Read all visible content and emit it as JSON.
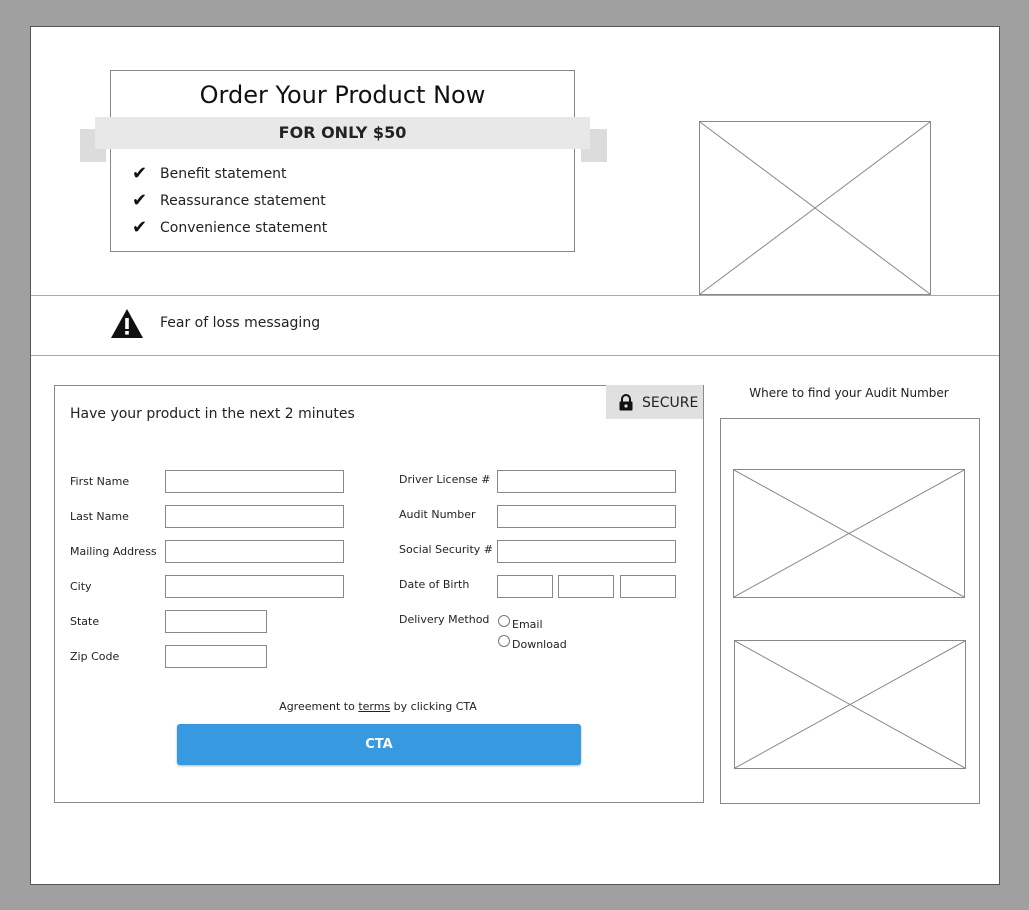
{
  "hero": {
    "title": "Order Your Product Now",
    "price_banner": "FOR ONLY $50",
    "benefits": [
      "Benefit statement",
      "Reassurance statement",
      "Convenience statement"
    ]
  },
  "alert": {
    "message": "Fear of loss messaging",
    "icon": "warning-triangle-icon"
  },
  "form": {
    "heading": "Have your product in the next 2 minutes",
    "secure_label": "SECURE",
    "secure_icon": "lock-icon",
    "left_fields": [
      "First Name",
      "Last Name",
      "Mailing Address",
      "City",
      "State",
      "Zip Code"
    ],
    "right_fields": [
      "Driver License #",
      "Audit Number",
      "Social Security #",
      "Date of Birth"
    ],
    "delivery": {
      "label": "Delivery Method",
      "options": [
        "Email",
        "Download"
      ]
    },
    "agreement_before": "Agreement to ",
    "agreement_link": "terms",
    "agreement_after": " by clicking CTA",
    "cta_label": "CTA",
    "cta_color": "#3799df"
  },
  "sidebar": {
    "title": "Where to find your Audit Number"
  }
}
